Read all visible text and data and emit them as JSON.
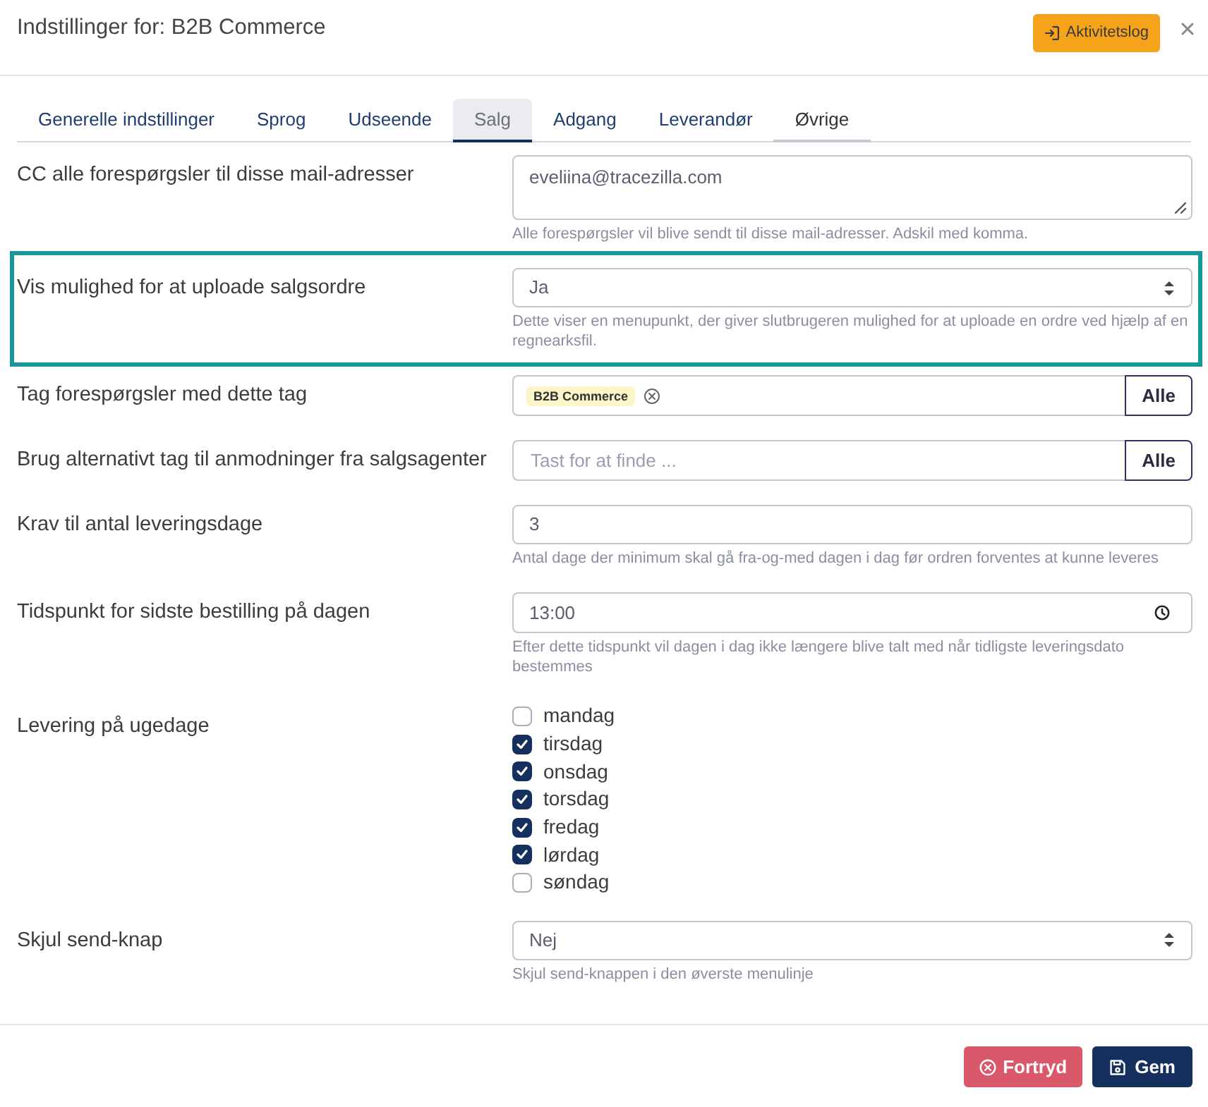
{
  "dialog": {
    "title": "Indstillinger for: B2B Commerce",
    "activity_button": "Aktivitetslog"
  },
  "tabs": [
    {
      "label": "Generelle indstillinger",
      "selected": false,
      "hovered": false
    },
    {
      "label": "Sprog",
      "selected": false,
      "hovered": false
    },
    {
      "label": "Udseende",
      "selected": false,
      "hovered": false
    },
    {
      "label": "Salg",
      "selected": true,
      "hovered": false
    },
    {
      "label": "Adgang",
      "selected": false,
      "hovered": false
    },
    {
      "label": "Leverandør",
      "selected": false,
      "hovered": false
    },
    {
      "label": "Øvrige",
      "selected": false,
      "hovered": true
    }
  ],
  "fields": [
    {
      "kind": "textarea",
      "label": "CC alle forespørgsler til disse mail-adresser",
      "value": "eveliina@tracezilla.com",
      "help": "Alle forespørgsler vil blive sendt til disse mail-adresser. Adskil med komma.",
      "highlighted": false
    },
    {
      "kind": "select",
      "label": "Vis mulighed for at uploade salgsordre",
      "value": "Ja",
      "help": "Dette viser en menupunkt, der giver slutbrugeren mulighed for at uploade en ordre ved hjælp af en regnearksfil.",
      "highlighted": true
    },
    {
      "kind": "tags",
      "label": "Tag forespørgsler med dette tag",
      "tags": [
        "B2B Commerce"
      ],
      "button": "Alle",
      "highlighted": false
    },
    {
      "kind": "tags",
      "label": "Brug alternativt tag til anmodninger fra salgsagenter",
      "placeholder": "Tast for at finde ...",
      "button": "Alle",
      "highlighted": false
    },
    {
      "kind": "text",
      "label": "Krav til antal leveringsdage",
      "value": "3",
      "help": "Antal dage der minimum skal gå fra-og-med dagen i dag før ordren forventes at kunne leveres",
      "highlighted": false
    },
    {
      "kind": "time",
      "label": "Tidspunkt for sidste bestilling på dagen",
      "value": "13:00",
      "help": "Efter dette tidspunkt vil dagen i dag ikke længere blive talt med når tidligste leveringsdato bestemmes",
      "highlighted": false
    },
    {
      "kind": "checkboxes",
      "label": "Levering på ugedage",
      "options": [
        {
          "label": "mandag",
          "checked": false
        },
        {
          "label": "tirsdag",
          "checked": true
        },
        {
          "label": "onsdag",
          "checked": true
        },
        {
          "label": "torsdag",
          "checked": true
        },
        {
          "label": "fredag",
          "checked": true
        },
        {
          "label": "lørdag",
          "checked": true
        },
        {
          "label": "søndag",
          "checked": false
        }
      ],
      "highlighted": false
    },
    {
      "kind": "select",
      "label": "Skjul send-knap",
      "value": "Nej",
      "help": "Skjul send-knappen i den øverste menulinje",
      "highlighted": false
    }
  ],
  "footer": {
    "cancel": "Fortryd",
    "save": "Gem"
  }
}
